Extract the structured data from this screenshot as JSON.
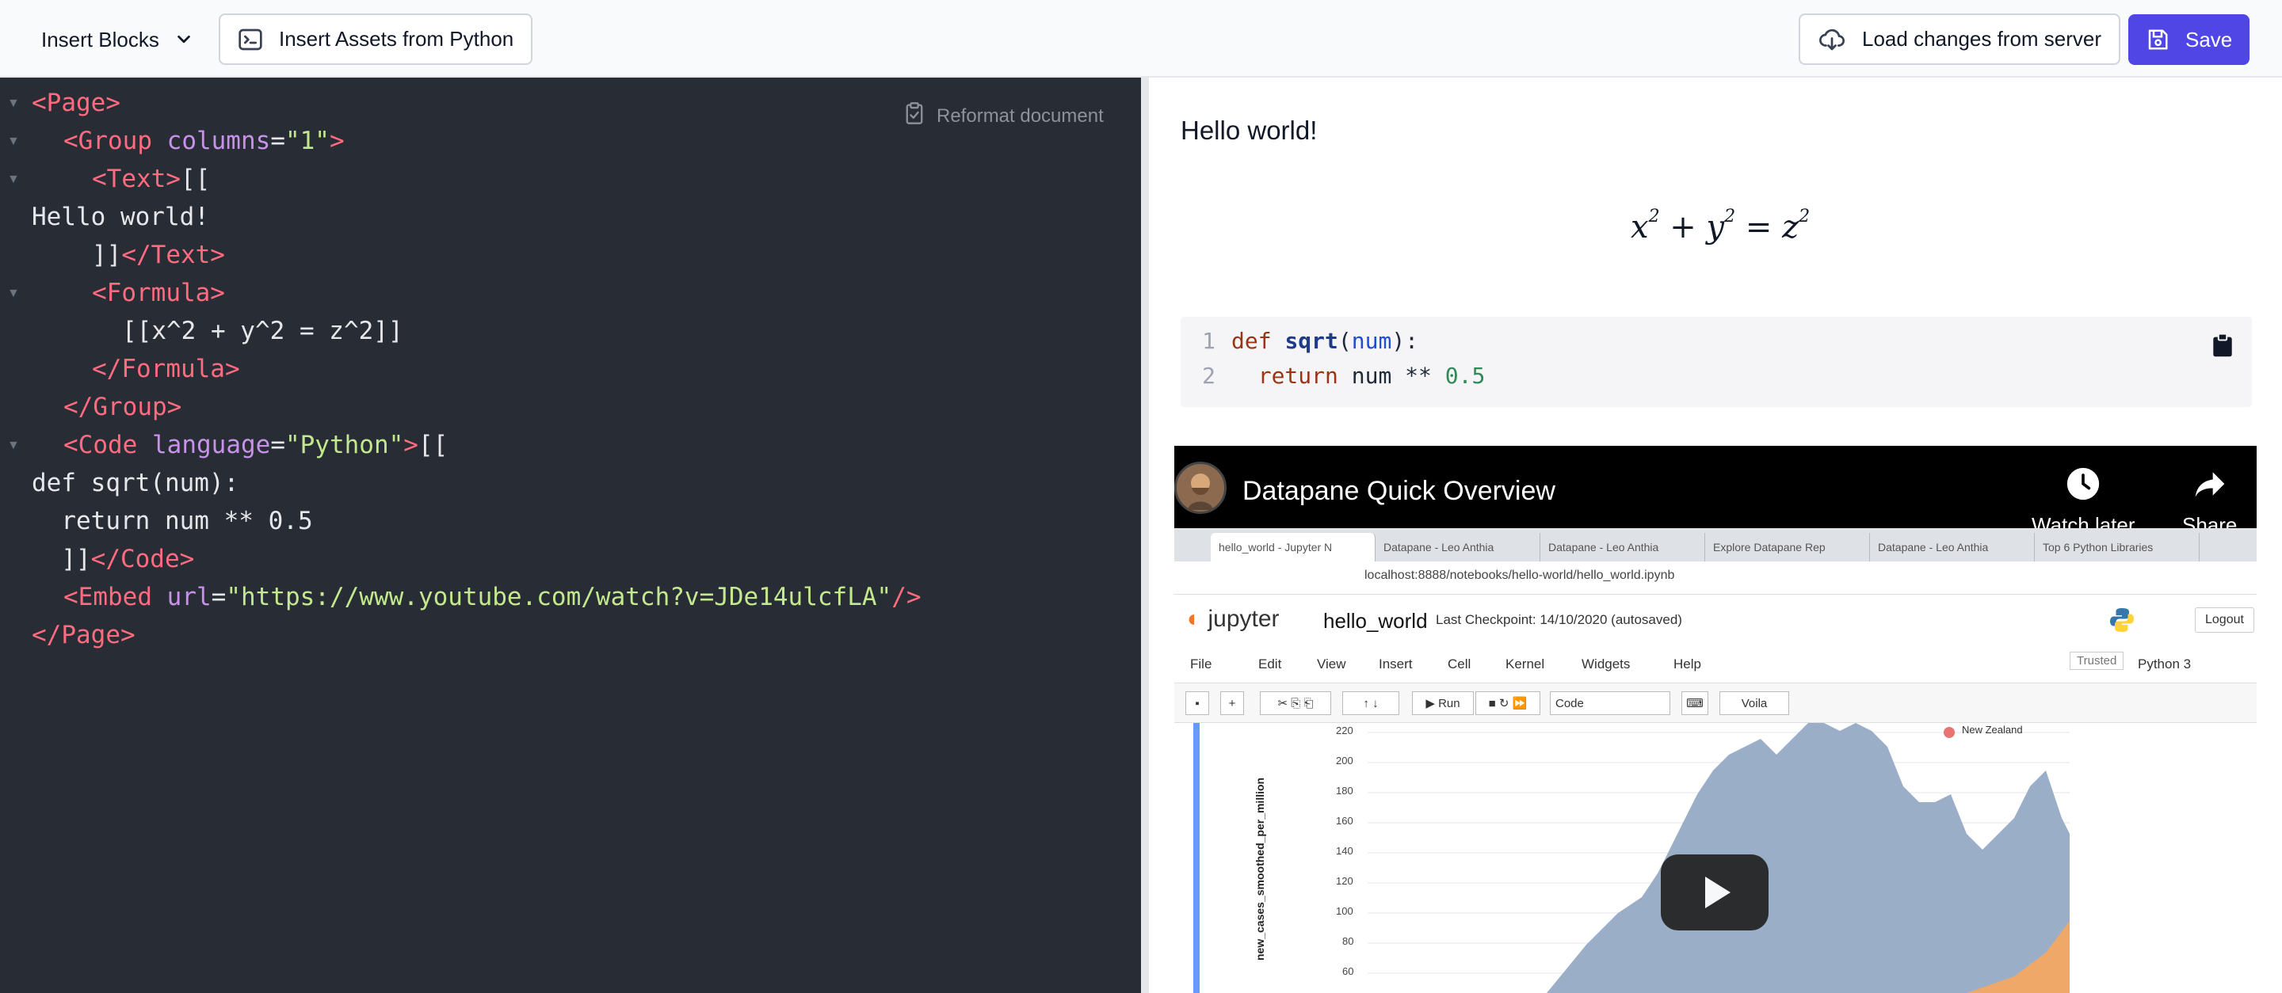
{
  "toolbar": {
    "insert_blocks": "Insert Blocks",
    "insert_assets": "Insert Assets from Python",
    "load_changes": "Load changes from server",
    "save": "Save"
  },
  "colors": {
    "accent": "#4f46e5",
    "editor_bg": "#282c34",
    "tag": "#ff6b7f",
    "attr": "#c792ea",
    "string": "#c3e88d"
  },
  "editor": {
    "reformat_label": "Reformat document",
    "lines": {
      "l1": "<Page>",
      "l2_open": "<Group",
      "l2_attr": "columns",
      "l2_eq": "=",
      "l2_val": "\"1\"",
      "l2_close": ">",
      "l3_tag": "<Text>",
      "l3_rest": "[[",
      "l4": "Hello world!",
      "l5_pre": "]]",
      "l5_tag": "</Text>",
      "l6": "<Formula>",
      "l7": "[[x^2 + y^2 = z^2]]",
      "l8": "</Formula>",
      "l9": "</Group>",
      "l10_open": "<Code",
      "l10_attr": "language",
      "l10_eq": "=",
      "l10_val": "\"Python\"",
      "l10_close": ">",
      "l10_rest": "[[",
      "l11": "def sqrt(num):",
      "l12": "  return num ** 0.5",
      "l13_pre": "  ]]",
      "l13_tag": "</Code>",
      "l14_open": "<Embed",
      "l14_attr": "url",
      "l14_eq": "=",
      "l14_val": "\"https://www.youtube.com/watch?v=JDe14ulcfLA\"",
      "l14_close": "/>",
      "l15": "</Page>"
    }
  },
  "preview": {
    "hello": "Hello world!",
    "formula": {
      "a": "x",
      "b": "y",
      "c": "z",
      "exp": "2",
      "plus": "+",
      "eq": "="
    },
    "code": {
      "n1": "1",
      "n2": "2",
      "def": "def",
      "fn": "sqrt",
      "open": "(",
      "param": "num",
      "close": "):",
      "ret": "return",
      "expr": "num **",
      "num": "0.5"
    },
    "video": {
      "title": "Datapane Quick Overview",
      "watch_later": "Watch later",
      "share": "Share",
      "tabs": [
        "hello_world - Jupyter N",
        "Datapane - Leo Anthia",
        "Datapane - Leo Anthia",
        "Explore Datapane Rep",
        "Datapane - Leo Anthia",
        "Top 6 Python Libraries"
      ],
      "url": "localhost:8888/notebooks/hello-world/hello_world.ipynb",
      "jupyter": "jupyter",
      "notebook_title": "hello_world",
      "checkpoint": "Last Checkpoint: 14/10/2020  (autosaved)",
      "logout": "Logout",
      "menu": [
        "File",
        "Edit",
        "View",
        "Insert",
        "Cell",
        "Kernel",
        "Widgets",
        "Help"
      ],
      "trusted": "Trusted",
      "kernel": "Python 3",
      "run": "Run",
      "cell_type": "Code",
      "voila": "Voila",
      "legend": "New Zealand",
      "ylabel": "new_cases_smoothed_per_million",
      "yticks": [
        "220",
        "200",
        "180",
        "160",
        "140",
        "120",
        "100",
        "80",
        "60"
      ]
    }
  }
}
